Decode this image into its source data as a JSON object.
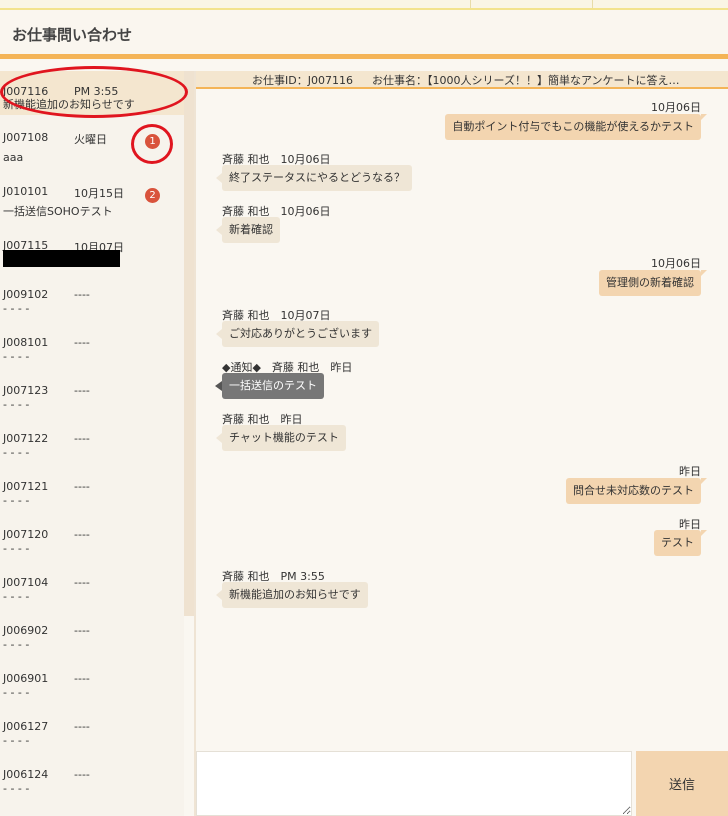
{
  "page": {
    "title": "お仕事問い合わせ"
  },
  "threads": [
    {
      "id": "J007116",
      "date": "PM 3:55",
      "preview": "新機能追加のお知らせです"
    },
    {
      "id": "J007108",
      "date": "火曜日",
      "preview": "aaa",
      "badge": "1"
    },
    {
      "id": "J010101",
      "date": "10月15日",
      "preview": "一括送信SOHOテスト",
      "badge": "2"
    },
    {
      "id": "J007115",
      "date": "10月07日",
      "preview": ""
    },
    {
      "id": "J009102",
      "date": "----",
      "preview": "- - - -"
    },
    {
      "id": "J008101",
      "date": "----",
      "preview": "- - - -"
    },
    {
      "id": "J007123",
      "date": "----",
      "preview": "- - - -"
    },
    {
      "id": "J007122",
      "date": "----",
      "preview": "- - - -"
    },
    {
      "id": "J007121",
      "date": "----",
      "preview": "- - - -"
    },
    {
      "id": "J007120",
      "date": "----",
      "preview": "- - - -"
    },
    {
      "id": "J007104",
      "date": "----",
      "preview": "- - - -"
    },
    {
      "id": "J006902",
      "date": "----",
      "preview": "- - - -"
    },
    {
      "id": "J006901",
      "date": "----",
      "preview": "- - - -"
    },
    {
      "id": "J006127",
      "date": "----",
      "preview": "- - - -"
    },
    {
      "id": "J006124",
      "date": "----",
      "preview": "- - - -"
    }
  ],
  "chat_header": {
    "job_id": "お仕事ID：J007116",
    "job_name": "お仕事名：【1000人シリーズ！！】簡単なアンケートに答え…"
  },
  "messages": [
    {
      "side": "right",
      "meta": "10月06日",
      "text": "自動ポイント付与でもこの機能が使えるかテスト"
    },
    {
      "side": "left",
      "meta": "斉藤 和也　10月06日",
      "text": "終了ステータスにやるとどうなる？"
    },
    {
      "side": "left",
      "meta": "斉藤 和也　10月06日",
      "text": "新着確認"
    },
    {
      "side": "right",
      "meta": "10月06日",
      "text": "管理側の新着確認"
    },
    {
      "side": "left",
      "meta": "斉藤 和也　10月07日",
      "text": "ご対応ありがとうございます"
    },
    {
      "side": "notice",
      "meta": "◆通知◆　斉藤 和也　昨日",
      "text": "一括送信のテスト"
    },
    {
      "side": "left",
      "meta": "斉藤 和也　昨日",
      "text": "チャット機能のテスト"
    },
    {
      "side": "right",
      "meta": "昨日",
      "text": "問合せ未対応数のテスト"
    },
    {
      "side": "right",
      "meta": "昨日",
      "text": "テスト"
    },
    {
      "side": "left",
      "meta": "斉藤 和也　PM 3:55",
      "text": "新機能追加のお知らせです"
    }
  ],
  "composer": {
    "placeholder": "",
    "value": ""
  },
  "send_label": "送信"
}
